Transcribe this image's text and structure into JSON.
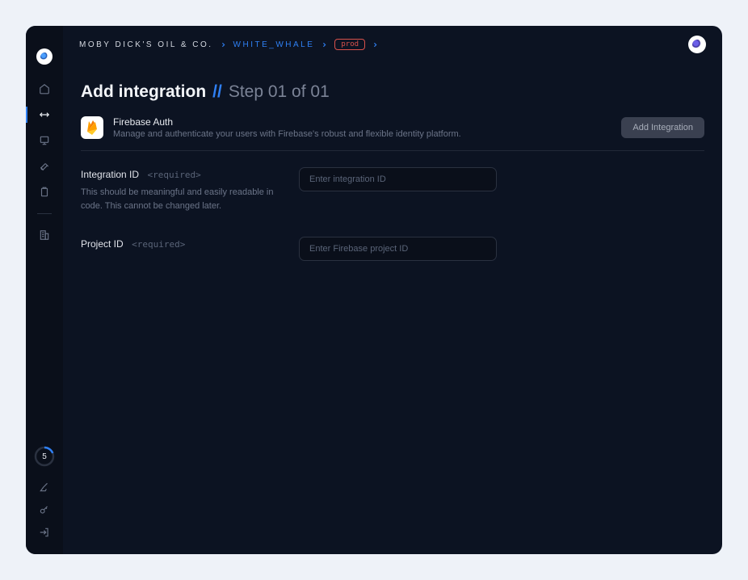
{
  "breadcrumb": {
    "org": "MOBY DICK'S OIL & CO.",
    "project": "WHITE_WHALE",
    "env": "prod"
  },
  "page": {
    "title": "Add integration",
    "separator": "//",
    "step": "Step 01 of 01"
  },
  "integration": {
    "name": "Firebase Auth",
    "description": "Manage and authenticate your users with Firebase's robust and flexible identity platform.",
    "button_label": "Add Integration"
  },
  "form": {
    "integration_id": {
      "label": "Integration ID",
      "required_tag": "<required>",
      "help": "This should be meaningful and easily readable in code. This cannot be changed later.",
      "placeholder": "Enter integration ID",
      "value": ""
    },
    "project_id": {
      "label": "Project ID",
      "required_tag": "<required>",
      "placeholder": "Enter Firebase project ID",
      "value": ""
    }
  },
  "sidebar": {
    "badge_value": "5"
  }
}
